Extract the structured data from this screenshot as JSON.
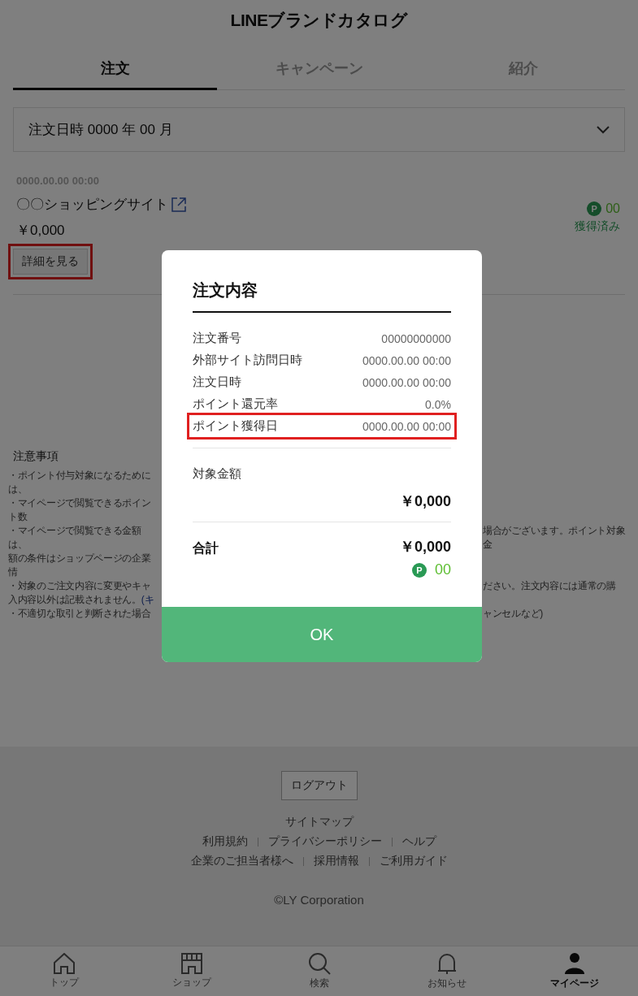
{
  "header": {
    "title": "LINEブランドカタログ"
  },
  "tabs": [
    {
      "label": "注文",
      "selected": true
    },
    {
      "label": "キャンペーン",
      "selected": false
    },
    {
      "label": "紹介",
      "selected": false
    }
  ],
  "month_select": {
    "label": "注文日時",
    "value": "0000 年 00 月"
  },
  "order": {
    "datetime": "0000.00.00 00:00",
    "shop": "〇〇ショッピングサイト",
    "price": "￥0,000",
    "point_mark": "P",
    "points": "00",
    "point_status": "獲得済み",
    "detail_button": {
      "label": "詳細を見る",
      "highlighted": true
    }
  },
  "notes": {
    "title": "注意事項",
    "lines": [
      {
        "left": "・ポイント付与対象になるためには、"
      },
      {
        "left": "・マイページで閲覧できるポイント数"
      },
      {
        "left": "・マイページで閲覧できる金額は、",
        "right": "場合がございます。ポイント対象金"
      },
      {
        "left": "額の条件はショップページの企業情"
      },
      {
        "left": "・対象のご注文内容に変更やキャ",
        "right": "ださい。注文内容には通常の購"
      },
      {
        "left": "入内容以外は記載されません。",
        "link": "(キ"
      },
      {
        "left": "・不適切な取引と判断された場合",
        "right": "ャンセルなど)"
      }
    ]
  },
  "footer": {
    "logout": "ログアウト",
    "link_rows": [
      [
        "サイトマップ"
      ],
      [
        "利用規約",
        "プライバシーポリシー",
        "ヘルプ"
      ],
      [
        "企業のご担当者様へ",
        "採用情報",
        "ご利用ガイド"
      ]
    ],
    "copyright": "©LY Corporation"
  },
  "bottom_nav": [
    {
      "label": "トップ",
      "selected": false
    },
    {
      "label": "ショップ",
      "selected": false
    },
    {
      "label": "検索",
      "selected": false
    },
    {
      "label": "お知らせ",
      "selected": false
    },
    {
      "label": "マイページ",
      "selected": true
    }
  ],
  "modal": {
    "title": "注文内容",
    "rows": [
      {
        "label": "注文番号",
        "value": "00000000000",
        "highlighted": false
      },
      {
        "label": "外部サイト訪問日時",
        "value": "0000.00.00 00:00",
        "highlighted": false
      },
      {
        "label": "注文日時",
        "value": "0000.00.00 00:00",
        "highlighted": false
      },
      {
        "label": "ポイント還元率",
        "value": "0.0%",
        "highlighted": false
      },
      {
        "label": "ポイント獲得日",
        "value": "0000.00.00 00:00",
        "highlighted": true
      }
    ],
    "target_label": "対象金額",
    "target_amount": "￥0,000",
    "total_label": "合計",
    "total_amount": "￥0,000",
    "point_mark": "P",
    "total_points": "00",
    "ok_button": "OK"
  }
}
